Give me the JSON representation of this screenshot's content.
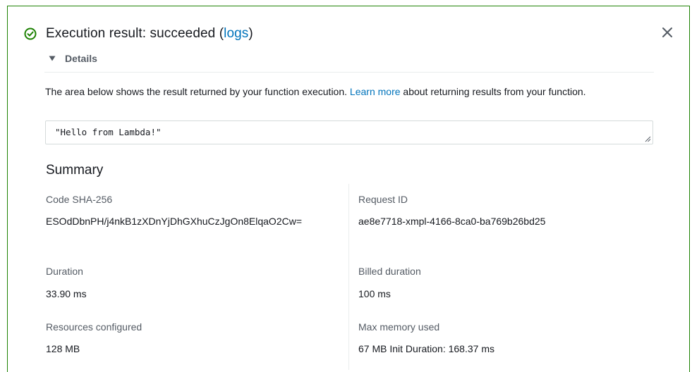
{
  "header": {
    "title_prefix": "Execution result: succeeded (",
    "title_link": "logs",
    "title_suffix": ")",
    "status": "succeeded",
    "status_color": "#1d8102",
    "status_icon": "check-circle-icon",
    "close_icon": "close-icon"
  },
  "details": {
    "toggle_label": "Details",
    "expanded": true,
    "description_before": "The area below shows the result returned by your function execution. ",
    "description_link": "Learn more",
    "description_after": " about returning results from your function.",
    "result": "\"Hello from Lambda!\""
  },
  "summary": {
    "title": "Summary",
    "fields": {
      "code_sha": {
        "label": "Code SHA-256",
        "value": "ESOdDbnPH/j4nkB1zXDnYjDhGXhuCzJgOn8ElqaO2Cw="
      },
      "request_id": {
        "label": "Request ID",
        "value": "ae8e7718-xmpl-4166-8ca0-ba769b26bd25"
      },
      "duration": {
        "label": "Duration",
        "value": "33.90 ms"
      },
      "billed_duration": {
        "label": "Billed duration",
        "value": "100 ms"
      },
      "resources_configured": {
        "label": "Resources configured",
        "value": "128 MB"
      },
      "max_memory_used": {
        "label": "Max memory used",
        "value": "67 MB Init Duration: 168.37 ms"
      }
    }
  },
  "colors": {
    "link": "#0073bb",
    "border": "#1d8102",
    "muted_text": "#545b64"
  }
}
